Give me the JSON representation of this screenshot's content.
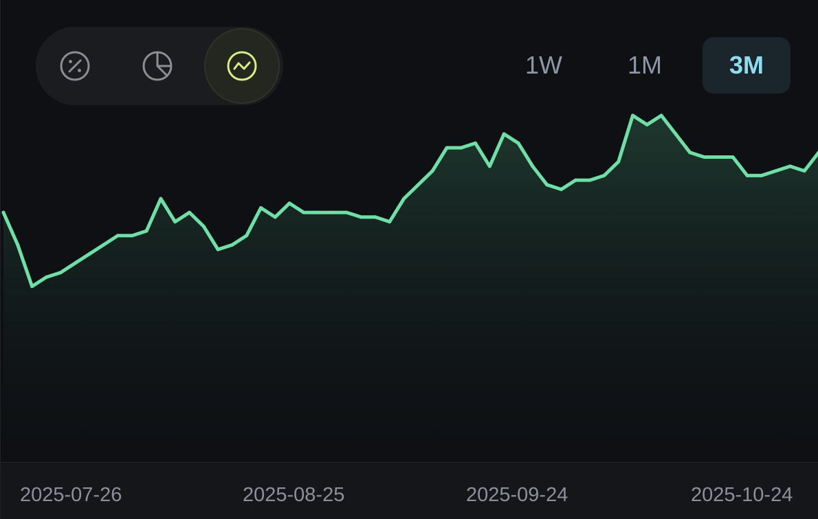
{
  "view_switch": {
    "buttons": [
      {
        "icon": "percent-icon",
        "active": false
      },
      {
        "icon": "pie-chart-icon",
        "active": false
      },
      {
        "icon": "line-chart-icon",
        "active": true
      }
    ]
  },
  "range_tabs": [
    {
      "label": "1W",
      "active": false
    },
    {
      "label": "1M",
      "active": false
    },
    {
      "label": "3M",
      "active": true
    }
  ],
  "colors": {
    "line": "#6fdfa6",
    "background": "#0e1014",
    "active_tab_text": "#8fdcf0",
    "active_view_icon": "#d7ee85",
    "inactive_icon": "#8b8e94"
  },
  "chart_data": {
    "type": "area",
    "title": "",
    "xlabel": "",
    "ylabel": "",
    "grid": false,
    "legend": "none",
    "x_ticks": [
      "2025-07-26",
      "2025-08-25",
      "2025-09-24",
      "2025-10-24"
    ],
    "x_start": "2025-07-26",
    "x_end": "2025-10-26",
    "ylim": [
      0,
      100
    ],
    "series": [
      {
        "name": "",
        "values": [
          54,
          47,
          38,
          40,
          41,
          43,
          45,
          47,
          49,
          49,
          50,
          57,
          52,
          54,
          51,
          46,
          47,
          49,
          55,
          53,
          56,
          54,
          54,
          54,
          54,
          53,
          53,
          52,
          57,
          60,
          63,
          68,
          68,
          69,
          64,
          71,
          69,
          64,
          60,
          59,
          61,
          61,
          62,
          65,
          75,
          73,
          75,
          71,
          67,
          66,
          66,
          66,
          62,
          62,
          63,
          64,
          63,
          67
        ]
      }
    ]
  }
}
